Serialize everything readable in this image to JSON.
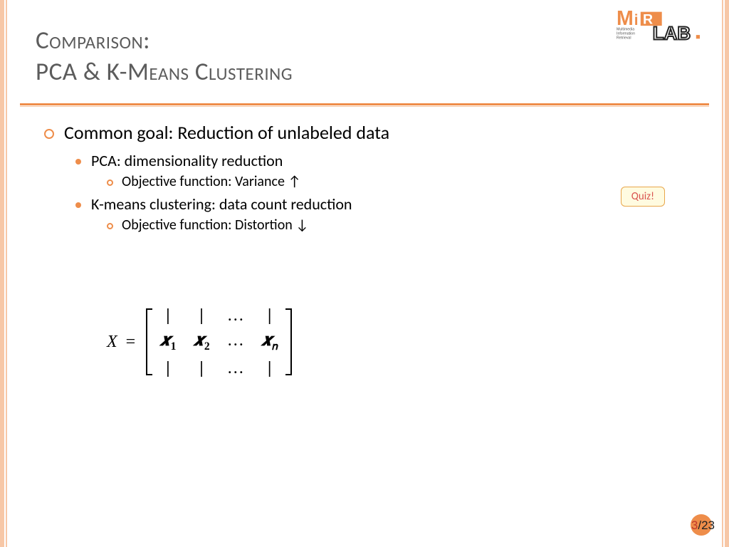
{
  "title": {
    "line1": "Comparison:",
    "line2": "PCA & K-Means Clustering"
  },
  "bullets": {
    "main": "Common goal: Reduction of unlabeled data",
    "pca": {
      "label": "PCA: dimensionality reduction",
      "sub": "Objective function: Variance ↑"
    },
    "kmeans": {
      "label": "K-means clustering: data count reduction",
      "sub": "Objective function: Distortion ↓"
    }
  },
  "quiz_label": "Quiz!",
  "equation": {
    "lhs": "X",
    "op": "=",
    "row_pipe": "|",
    "row_dots": "…",
    "cols": [
      "𝒙1",
      "𝒙2",
      "…",
      "𝒙𝑛"
    ]
  },
  "page": {
    "current": "3",
    "sep": "/",
    "total": "23"
  },
  "logo": {
    "brand_top": "MiR",
    "brand_sub1": "Multimedia",
    "brand_sub2": "Information",
    "brand_sub3": "Retrieval",
    "brand_right": "LAB."
  },
  "colors": {
    "accent": "#ee8d4a",
    "title": "#5c5c5c"
  }
}
